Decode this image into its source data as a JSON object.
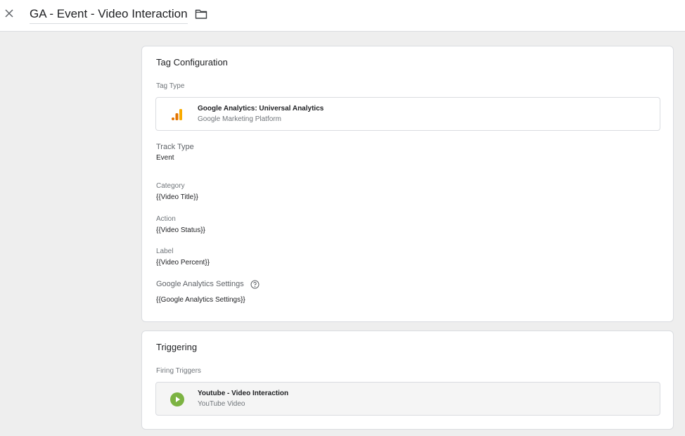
{
  "header": {
    "tag_name": "GA - Event - Video Interaction"
  },
  "icons": {
    "close": "close-icon",
    "folder": "folder-icon",
    "analytics": "google-analytics-icon",
    "help": "help-icon",
    "play": "play-icon"
  },
  "colors": {
    "analytics_orange": "#f9ab00",
    "analytics_dark_orange": "#e37400",
    "trigger_green": "#7cb342"
  },
  "config": {
    "title": "Tag Configuration",
    "tag_type_label": "Tag Type",
    "tag_type_name": "Google Analytics: Universal Analytics",
    "tag_type_platform": "Google Marketing Platform",
    "track_type_label": "Track Type",
    "track_type_value": "Event",
    "category_label": "Category",
    "category_value": "{{Video Title}}",
    "action_label": "Action",
    "action_value": "{{Video Status}}",
    "label_label": "Label",
    "label_value": "{{Video Percent}}",
    "settings_label": "Google Analytics Settings",
    "settings_value": "{{Google Analytics Settings}}"
  },
  "triggering": {
    "title": "Triggering",
    "firing_label": "Firing Triggers",
    "trigger_name": "Youtube - Video Interaction",
    "trigger_type": "YouTube Video"
  }
}
